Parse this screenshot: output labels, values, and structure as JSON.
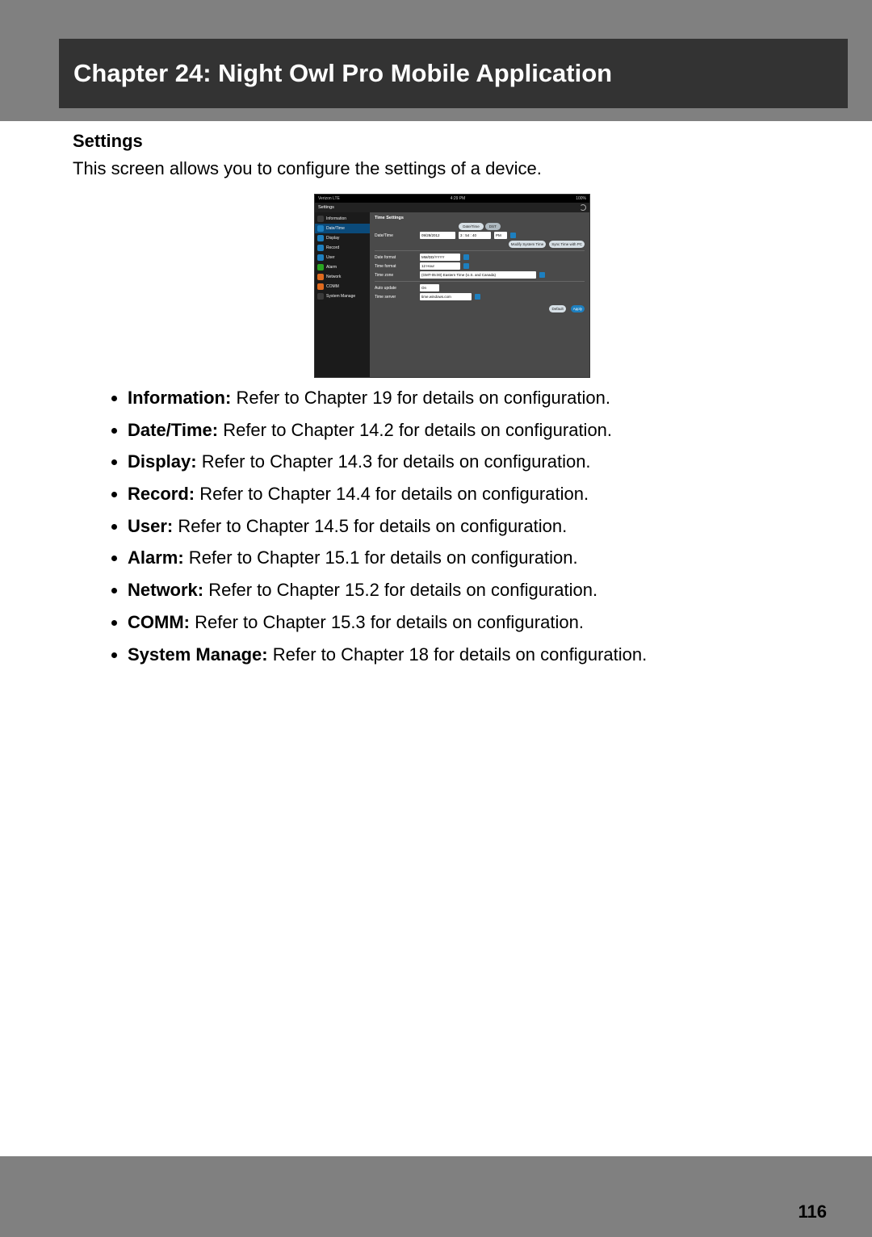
{
  "header": {
    "title": "Chapter 24: Night Owl Pro Mobile Application"
  },
  "section": {
    "title": "Settings"
  },
  "intro": "This screen allows you to configure the settings of a device.",
  "screenshot": {
    "status": {
      "left": "Verizon  LTE",
      "center": "4:29 PM",
      "right": "100%"
    },
    "topbar": {
      "title": "Settings"
    },
    "sidebar": [
      {
        "label": "Information",
        "color": "#3a3a3a"
      },
      {
        "label": "Date/Time",
        "color": "#1d7fbf",
        "selected": true
      },
      {
        "label": "Display",
        "color": "#1d7fbf"
      },
      {
        "label": "Record",
        "color": "#1d7fbf"
      },
      {
        "label": "User",
        "color": "#1d7fbf"
      },
      {
        "label": "Alarm",
        "color": "#2aa521"
      },
      {
        "label": "Network",
        "color": "#e06a1e"
      },
      {
        "label": "COMM",
        "color": "#e06a1e"
      },
      {
        "label": "System Manage",
        "color": "#3a3a3a"
      }
    ],
    "panel": {
      "title": "Time Settings",
      "tabs": {
        "active": "Date/Time",
        "other": "DST"
      },
      "rows": {
        "date_time_label": "Date/Time",
        "date_value": "09/28/2012",
        "time_value": "3 : 54 : 40",
        "ampm": "PM",
        "modify_btn": "Modify System Time",
        "sync_btn": "Sync Time with PC",
        "date_format_label": "Date format",
        "date_format_value": "MM/DD/YYYY",
        "time_format_label": "Time format",
        "time_format_value": "12 Hour",
        "time_zone_label": "Time zone",
        "time_zone_value": "(GMT-05:00) Eastern Time (U.S. and Canada)",
        "auto_update_label": "Auto update",
        "auto_update_value": "On",
        "time_server_label": "Time server",
        "time_server_value": "time.windows.com"
      },
      "footer": {
        "default": "Default",
        "apply": "Apply"
      }
    }
  },
  "features": [
    {
      "label": "Information:",
      "text": " Refer to Chapter 19 for details on configuration."
    },
    {
      "label": "Date/Time:",
      "text": " Refer to Chapter 14.2 for details on configuration."
    },
    {
      "label": "Display:",
      "text": " Refer to Chapter 14.3 for details on configuration."
    },
    {
      "label": "Record:",
      "text": " Refer to Chapter 14.4 for details on configuration."
    },
    {
      "label": "User:",
      "text": " Refer to Chapter 14.5 for details on configuration."
    },
    {
      "label": "Alarm:",
      "text": " Refer to Chapter 15.1 for details on configuration."
    },
    {
      "label": "Network:",
      "text": " Refer to Chapter 15.2 for details on configuration."
    },
    {
      "label": "COMM:",
      "text": " Refer to Chapter 15.3 for details on configuration."
    },
    {
      "label": "System Manage:",
      "text": " Refer to Chapter 18 for details on configuration."
    }
  ],
  "page_number": "116"
}
